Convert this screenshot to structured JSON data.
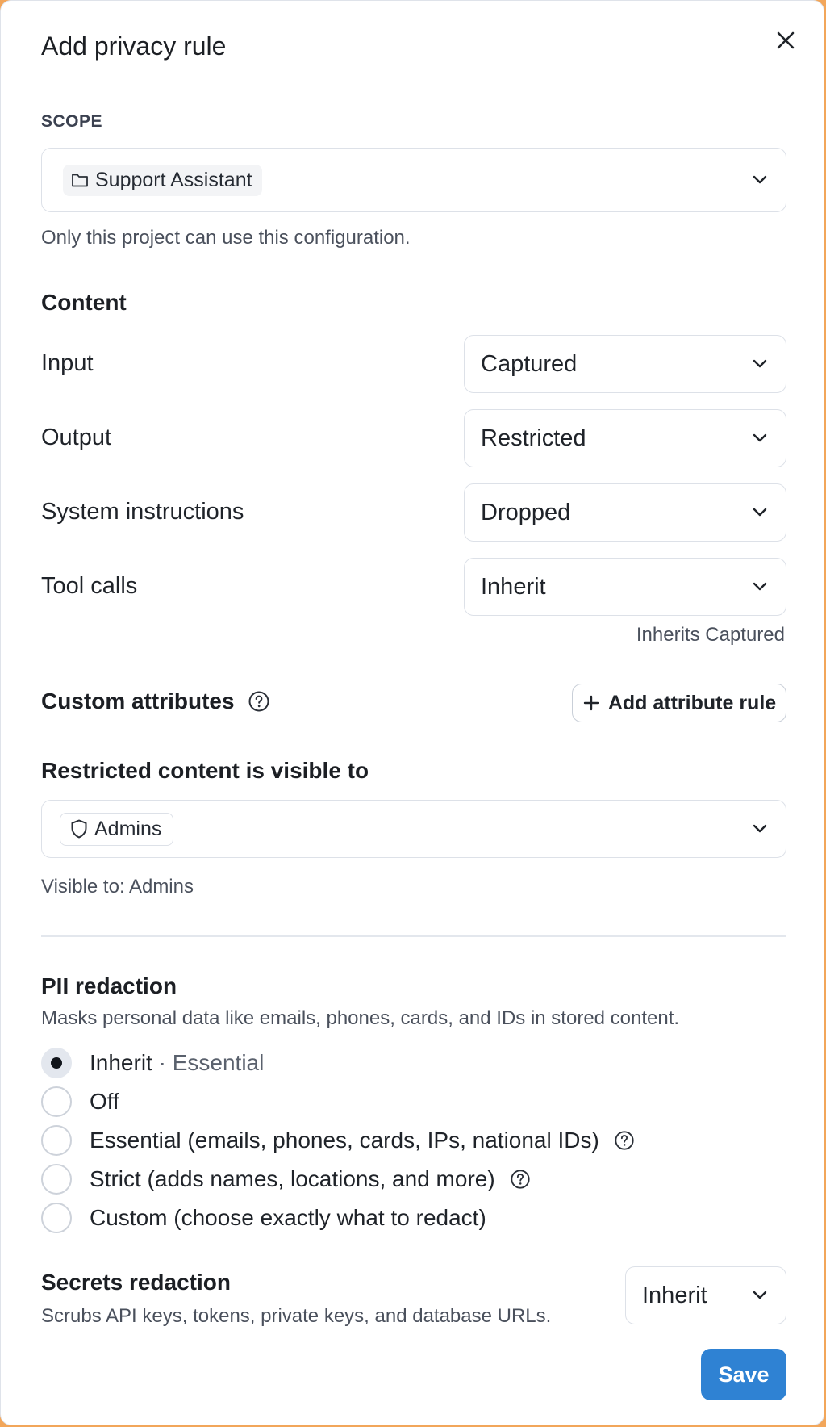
{
  "dialog": {
    "title": "Add privacy rule"
  },
  "scope": {
    "label": "SCOPE",
    "selected": "Support Assistant",
    "help": "Only this project can use this configuration."
  },
  "content": {
    "heading": "Content",
    "rows": [
      {
        "label": "Input",
        "value": "Captured"
      },
      {
        "label": "Output",
        "value": "Restricted"
      },
      {
        "label": "System instructions",
        "value": "Dropped"
      },
      {
        "label": "Tool calls",
        "value": "Inherit"
      }
    ],
    "tool_calls_hint": "Inherits Captured"
  },
  "custom_attributes": {
    "heading": "Custom attributes",
    "add_button": "Add attribute rule"
  },
  "visibility": {
    "heading": "Restricted content is visible to",
    "selected": "Admins",
    "help": "Visible to: Admins"
  },
  "pii": {
    "heading": "PII redaction",
    "description": "Masks personal data like emails, phones, cards, and IDs in stored content.",
    "options": [
      {
        "label": "Inherit",
        "suffix": "· Essential",
        "checked": true
      },
      {
        "label": "Off"
      },
      {
        "label": "Essential (emails, phones, cards, IPs, national IDs)"
      },
      {
        "label": "Strict (adds names, locations, and more)"
      },
      {
        "label": "Custom (choose exactly what to redact)"
      }
    ]
  },
  "secrets": {
    "heading": "Secrets redaction",
    "description": "Scrubs API keys, tokens, private keys, and database URLs.",
    "value": "Inherit"
  },
  "footer": {
    "save_label": "Save"
  },
  "colors": {
    "primary": "#2f82d3",
    "border": "#dde1e8",
    "backdrop": "#f2a65a"
  }
}
